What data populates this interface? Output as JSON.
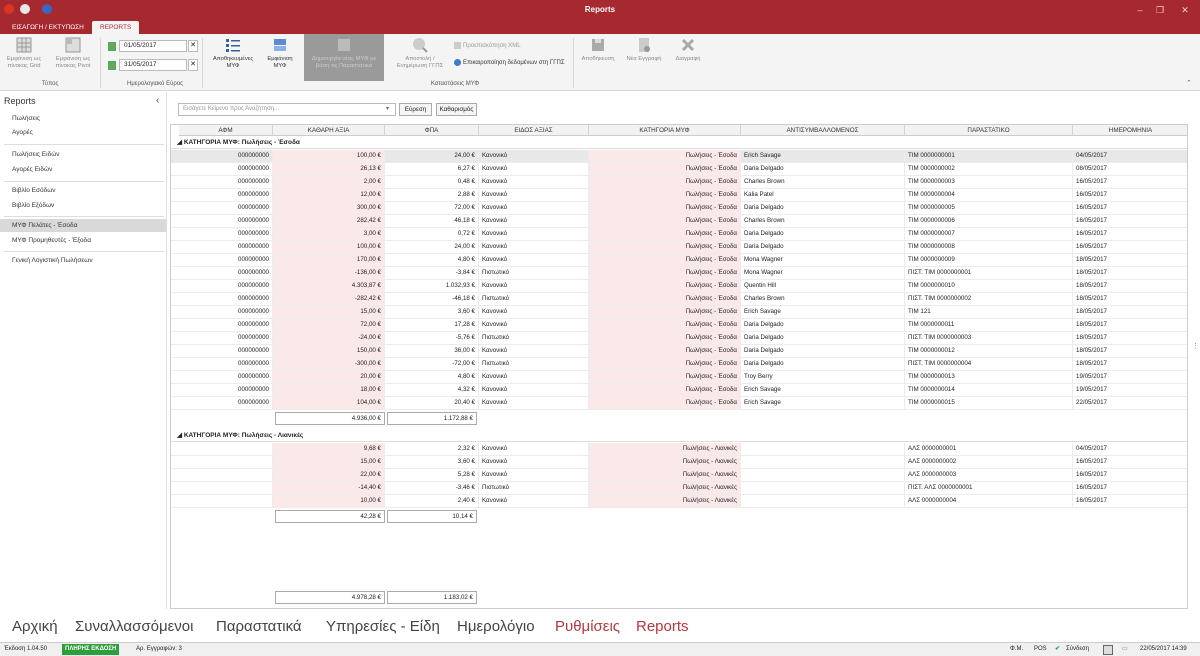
{
  "window": {
    "title": "Reports"
  },
  "tabs": [
    "ΕΙΣΑΓΩΓΗ / ΕΚΤΥΠΩΣΗ",
    "REPORTS"
  ],
  "ribbon": {
    "grid_btn": "Εμφάνιση ως\nπίνακας Grid",
    "pivot_btn": "Εμφάνιση ως\nπίνακας Pivot",
    "group_type": "Τύπος",
    "date_from": "01/05/2017",
    "date_to": "31/05/2017",
    "group_dates": "Ημερολογιακό Εύρος",
    "saved_btn": "Αποθηκευμένες\nΜΥΦ",
    "show_btn": "Εμφάνιση\nΜΥΦ",
    "join_btn": "Δημιουργία νέας ΜΥΦ με\nβάση τις Παραστατικά",
    "send_btn": "Αποστολή /\nΕνημέρωση ΓΓΠΣ",
    "preview_xml": "Προεπισκόπηση XML",
    "update_ggps": "Επικαιροποίηση δεδομένων στη ΓΓΠΣ",
    "group_myf": "Καταστάσεις ΜΥΦ",
    "save_btn": "Αποθήκευση",
    "new_btn": "Νέα Εγγραφή",
    "delete_btn": "Διαγραφή"
  },
  "sidebar": {
    "title": "Reports",
    "items": [
      "Πωλήσεις",
      "Αγορές",
      "Πωλήσεις Ειδών",
      "Αγορές Ειδών",
      "Βιβλίο Εσόδων",
      "Βιβλίο Εξόδων",
      "ΜΥΦ Πελάτες - Έσοδα",
      "ΜΥΦ Προμηθευτές - Έξοδα",
      "Γενική Λογιστική Πωλήσεων"
    ]
  },
  "search": {
    "placeholder": "Εισάγετε Κείμενο προς Αναζήτηση...",
    "find": "Εύρεση",
    "clear": "Καθαρισμός"
  },
  "grid": {
    "headers": [
      "ΑΦΜ",
      "ΚΑΘΑΡΗ ΑΞΙΑ",
      "ΦΠΑ",
      "ΕΙΔΟΣ ΑΞΙΑΣ",
      "ΚΑΤΗΓΟΡΙΑ ΜΥΦ",
      "ΑΝΤΙΣΥΜΒΑΛΛΟΜΕΝΟΣ",
      "ΠΑΡΑΣΤΑΤΙΚΟ",
      "ΗΜΕΡΟΜΗΝΙΑ"
    ],
    "group1": {
      "title": "ΚΑΤΗΓΟΡΙΑ ΜΥΦ: Πωλήσεις - Έσοδα",
      "total_net": "4.936,00 €",
      "total_vat": "1.172,88 €",
      "rows": [
        [
          "000000000",
          "100,00 €",
          "24,00 €",
          "Κανονικό",
          "Πωλήσεις - Έσοδα",
          "Erich Savage",
          "ΤΙΜ 0000000001",
          "04/05/2017"
        ],
        [
          "000000000",
          "26,13 €",
          "6,27 €",
          "Κανονικό",
          "Πωλήσεις - Έσοδα",
          "Daria Delgado",
          "ΤΙΜ 0000000002",
          "08/05/2017"
        ],
        [
          "000000000",
          "2,00 €",
          "0,48 €",
          "Κανονικό",
          "Πωλήσεις - Έσοδα",
          "Charles Brown",
          "ΤΙΜ 0000000003",
          "16/05/2017"
        ],
        [
          "000000000",
          "12,00 €",
          "2,88 €",
          "Κανονικό",
          "Πωλήσεις - Έσοδα",
          "Kalia Patel",
          "ΤΙΜ 0000000004",
          "16/05/2017"
        ],
        [
          "000000000",
          "300,00 €",
          "72,00 €",
          "Κανονικό",
          "Πωλήσεις - Έσοδα",
          "Daria Delgado",
          "ΤΙΜ 0000000005",
          "16/05/2017"
        ],
        [
          "000000000",
          "282,42 €",
          "46,18 €",
          "Κανονικό",
          "Πωλήσεις - Έσοδα",
          "Charles Brown",
          "ΤΙΜ 0000000006",
          "16/05/2017"
        ],
        [
          "000000000",
          "3,00 €",
          "0,72 €",
          "Κανονικό",
          "Πωλήσεις - Έσοδα",
          "Daria Delgado",
          "ΤΙΜ 0000000007",
          "16/05/2017"
        ],
        [
          "000000000",
          "100,00 €",
          "24,00 €",
          "Κανονικό",
          "Πωλήσεις - Έσοδα",
          "Daria Delgado",
          "ΤΙΜ 0000000008",
          "16/05/2017"
        ],
        [
          "000000000",
          "170,00 €",
          "4,80 €",
          "Κανονικό",
          "Πωλήσεις - Έσοδα",
          "Mona Wagner",
          "ΤΙΜ 0000000009",
          "18/05/2017"
        ],
        [
          "000000000",
          "-136,00 €",
          "-3,84 €",
          "Πιστωτικό",
          "Πωλήσεις - Έσοδα",
          "Mona Wagner",
          "ΠΙΣΤ. ΤΙΜ 0000000001",
          "18/05/2017"
        ],
        [
          "000000000",
          "4.303,87 €",
          "1.032,93 €",
          "Κανονικό",
          "Πωλήσεις - Έσοδα",
          "Quentin Hill",
          "ΤΙΜ 0000000010",
          "18/05/2017"
        ],
        [
          "000000000",
          "-282,42 €",
          "-46,18 €",
          "Πιστωτικό",
          "Πωλήσεις - Έσοδα",
          "Charles Brown",
          "ΠΙΣΤ. ΤΙΜ 0000000002",
          "18/05/2017"
        ],
        [
          "000000000",
          "15,00 €",
          "3,60 €",
          "Κανονικό",
          "Πωλήσεις - Έσοδα",
          "Erich Savage",
          "ΤΙΜ 121",
          "18/05/2017"
        ],
        [
          "000000000",
          "72,00 €",
          "17,28 €",
          "Κανονικό",
          "Πωλήσεις - Έσοδα",
          "Daria Delgado",
          "ΤΙΜ 0000000011",
          "18/05/2017"
        ],
        [
          "000000000",
          "-24,00 €",
          "-5,76 €",
          "Πιστωτικό",
          "Πωλήσεις - Έσοδα",
          "Daria Delgado",
          "ΠΙΣΤ. ΤΙΜ 0000000003",
          "18/05/2017"
        ],
        [
          "000000000",
          "150,00 €",
          "36,00 €",
          "Κανονικό",
          "Πωλήσεις - Έσοδα",
          "Daria Delgado",
          "ΤΙΜ 0000000012",
          "18/05/2017"
        ],
        [
          "000000000",
          "-300,00 €",
          "-72,00 €",
          "Πιστωτικό",
          "Πωλήσεις - Έσοδα",
          "Daria Delgado",
          "ΠΙΣΤ. ΤΙΜ 0000000004",
          "18/05/2017"
        ],
        [
          "000000000",
          "20,00 €",
          "4,80 €",
          "Κανονικό",
          "Πωλήσεις - Έσοδα",
          "Troy Berry",
          "ΤΙΜ 0000000013",
          "19/05/2017"
        ],
        [
          "000000000",
          "18,00 €",
          "4,32 €",
          "Κανονικό",
          "Πωλήσεις - Έσοδα",
          "Erich Savage",
          "ΤΙΜ 0000000014",
          "19/05/2017"
        ],
        [
          "000000000",
          "104,00 €",
          "20,40 €",
          "Κανονικό",
          "Πωλήσεις - Έσοδα",
          "Erich Savage",
          "ΤΙΜ 0000000015",
          "22/05/2017"
        ]
      ]
    },
    "group2": {
      "title": "ΚΑΤΗΓΟΡΙΑ ΜΥΦ: Πωλήσεις - Λιανικές",
      "total_net": "42,28 €",
      "total_vat": "10,14 €",
      "rows": [
        [
          "",
          "9,68 €",
          "2,32 €",
          "Κανονικό",
          "Πωλήσεις - Λιανικές",
          "",
          "ΑΛΣ 0000000001",
          "04/05/2017"
        ],
        [
          "",
          "15,00 €",
          "3,60 €",
          "Κανονικό",
          "Πωλήσεις - Λιανικές",
          "",
          "ΑΛΣ 0000000002",
          "16/05/2017"
        ],
        [
          "",
          "22,00 €",
          "5,28 €",
          "Κανονικό",
          "Πωλήσεις - Λιανικές",
          "",
          "ΑΛΣ 0000000003",
          "16/05/2017"
        ],
        [
          "",
          "-14,40 €",
          "-3,46 €",
          "Πιστωτικό",
          "Πωλήσεις - Λιανικές",
          "",
          "ΠΙΣΤ. ΑΛΣ 0000000001",
          "16/05/2017"
        ],
        [
          "",
          "10,00 €",
          "2,40 €",
          "Κανονικό",
          "Πωλήσεις - Λιανικές",
          "",
          "ΑΛΣ 0000000004",
          "16/05/2017"
        ]
      ]
    },
    "grand_net": "4.978,28 €",
    "grand_vat": "1.183,02 €"
  },
  "nav": [
    "Αρχική",
    "Συναλλασσόμενοι",
    "Παραστατικά",
    "Υπηρεσίες - Είδη",
    "Ημερολόγιο",
    "Ρυθμίσεις",
    "Reports"
  ],
  "status": {
    "version": "Έκδοση 1.04.50",
    "edition": "ΠΛΗΡΗΣ ΕΚΔΟΣΗ",
    "records": "Αρ. Εγγραφών: 3",
    "fm": "Φ.Μ.",
    "pos": "POS",
    "connect": "Σύνδεση",
    "datetime": "22/05/2017 14:39"
  }
}
